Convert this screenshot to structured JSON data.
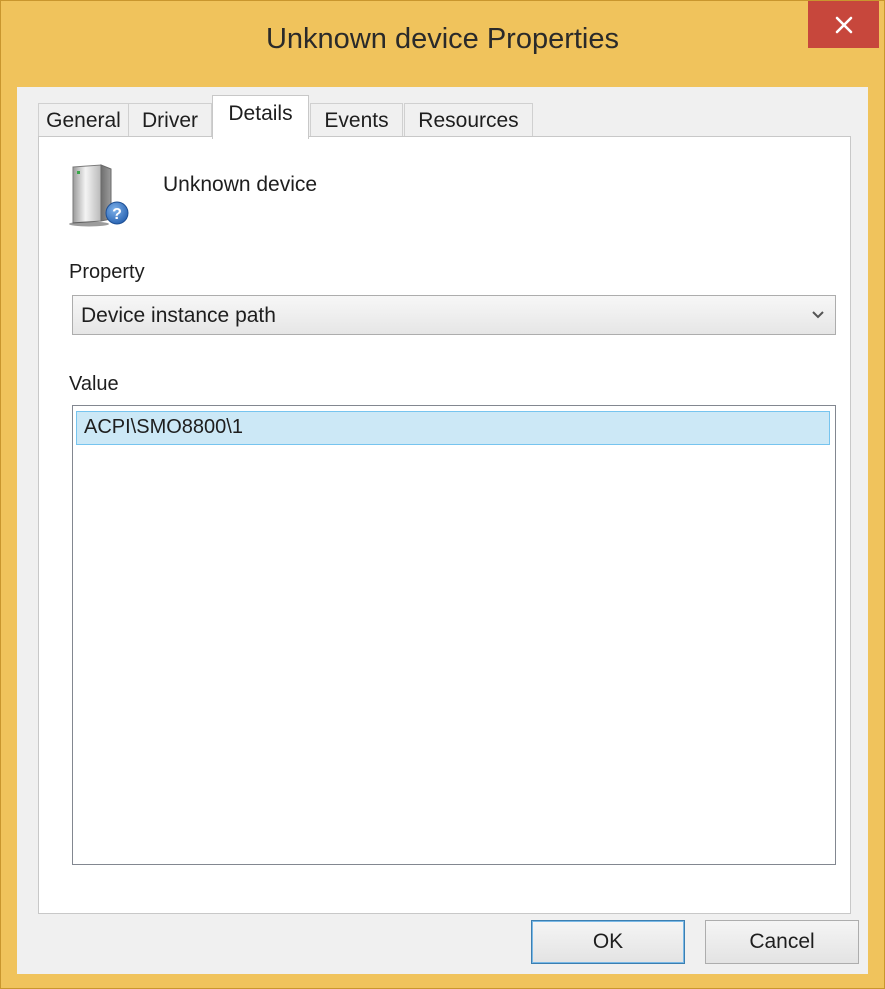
{
  "window": {
    "title": "Unknown device Properties",
    "close_glyph": "✕",
    "frame_color": "#f0c35c",
    "close_color": "#c7473c"
  },
  "tabs": [
    {
      "label": "General"
    },
    {
      "label": "Driver"
    },
    {
      "label": "Details",
      "active": true
    },
    {
      "label": "Events"
    },
    {
      "label": "Resources"
    }
  ],
  "device": {
    "icon": "unknown-device-icon",
    "name": "Unknown device"
  },
  "property": {
    "label": "Property",
    "selected": "Device instance path"
  },
  "value": {
    "label": "Value",
    "items": [
      "ACPI\\SMO8800\\1"
    ],
    "selection_color": "#cce8f6"
  },
  "buttons": {
    "ok": "OK",
    "cancel": "Cancel"
  }
}
